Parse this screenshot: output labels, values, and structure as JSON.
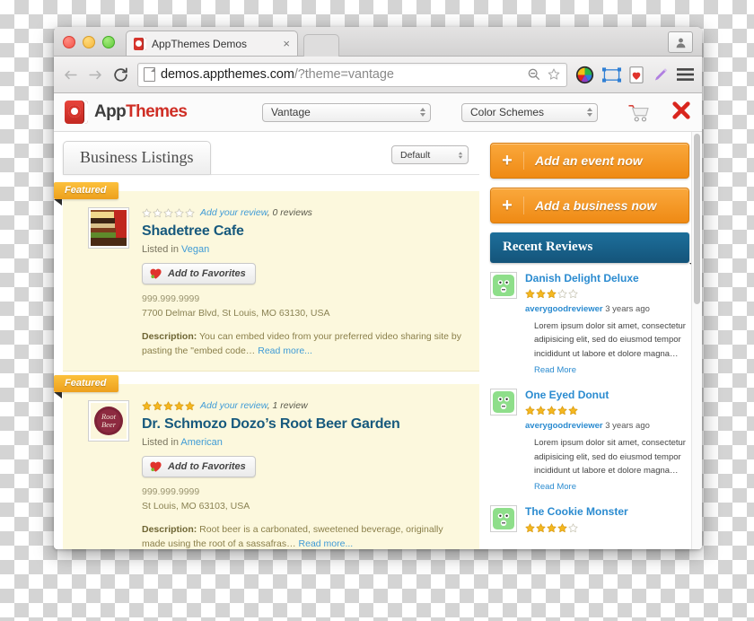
{
  "browser": {
    "tab_title": "AppThemes Demos",
    "tab_close": "×",
    "back_icon": "back-arrow-icon",
    "forward_icon": "forward-arrow-icon",
    "reload_icon": "reload-icon",
    "url_main": "demos.appthemes.com",
    "url_query": "/?theme=vantage",
    "toolbar_icons": [
      "zoom-out-icon",
      "bookmark-star-icon",
      "color-wheel-icon",
      "selection-frame-icon",
      "heart-card-icon",
      "pen-icon",
      "hamburger-menu-icon"
    ]
  },
  "site": {
    "logo_part_a": "App",
    "logo_part_b": "Themes",
    "theme_select": "Vantage",
    "scheme_select": "Color Schemes",
    "cart_icon": "shopping-cart-icon",
    "close_icon": "close-x-icon"
  },
  "main": {
    "page_tab": "Business Listings",
    "sort_select": "Default",
    "featured_badge": "Featured",
    "listings": [
      {
        "thumb": "sandwich-photo",
        "rating": 0,
        "add_review": "Add your review",
        "review_count": ", 0 reviews",
        "name": "Shadetree Cafe",
        "listed_prefix": "Listed in ",
        "category": "Vegan",
        "fav_label": "Add to Favorites",
        "phone": "999.999.9999",
        "address": "7700 Delmar Blvd, St Louis, MO 63130, USA",
        "desc_label": "Description:",
        "desc_text": " You can embed video from your preferred video sharing site by pasting the \"embed code… ",
        "read_more": "Read more..."
      },
      {
        "thumb": "root-beer-cap",
        "rating": 5,
        "add_review": "Add your review",
        "review_count": ", 1 review",
        "name": "Dr. Schmozo Dozo’s Root Beer Garden",
        "listed_prefix": "Listed in ",
        "category": "American",
        "fav_label": "Add to Favorites",
        "phone": "999.999.9999",
        "address": "St Louis, MO 63103, USA",
        "desc_label": "Description:",
        "desc_text": " Root beer is a carbonated, sweetened beverage, originally made using the root of a sassafras… ",
        "read_more": "Read more..."
      }
    ]
  },
  "sidebar": {
    "cta_event": "Add an event now",
    "cta_business": "Add a business now",
    "plus": "+",
    "recent_reviews_title": "Recent Reviews",
    "reviews": [
      {
        "title": "Danish Delight Deluxe",
        "rating": 3,
        "author": "averygoodreviewer",
        "time": " 3 years ago",
        "text": "Lorem ipsum dolor sit amet, consectetur adipisicing elit, sed do eiusmod tempor incididunt ut labore et dolore magna…",
        "read_more": "Read More"
      },
      {
        "title": "One Eyed Donut",
        "rating": 5,
        "author": "averygoodreviewer",
        "time": " 3 years ago",
        "text": "Lorem ipsum dolor sit amet, consectetur adipisicing elit, sed do eiusmod tempor incididunt ut labore et dolore magna…",
        "read_more": "Read More"
      },
      {
        "title": "The Cookie Monster",
        "rating": 4,
        "author": "",
        "time": "",
        "text": "",
        "read_more": ""
      }
    ]
  }
}
